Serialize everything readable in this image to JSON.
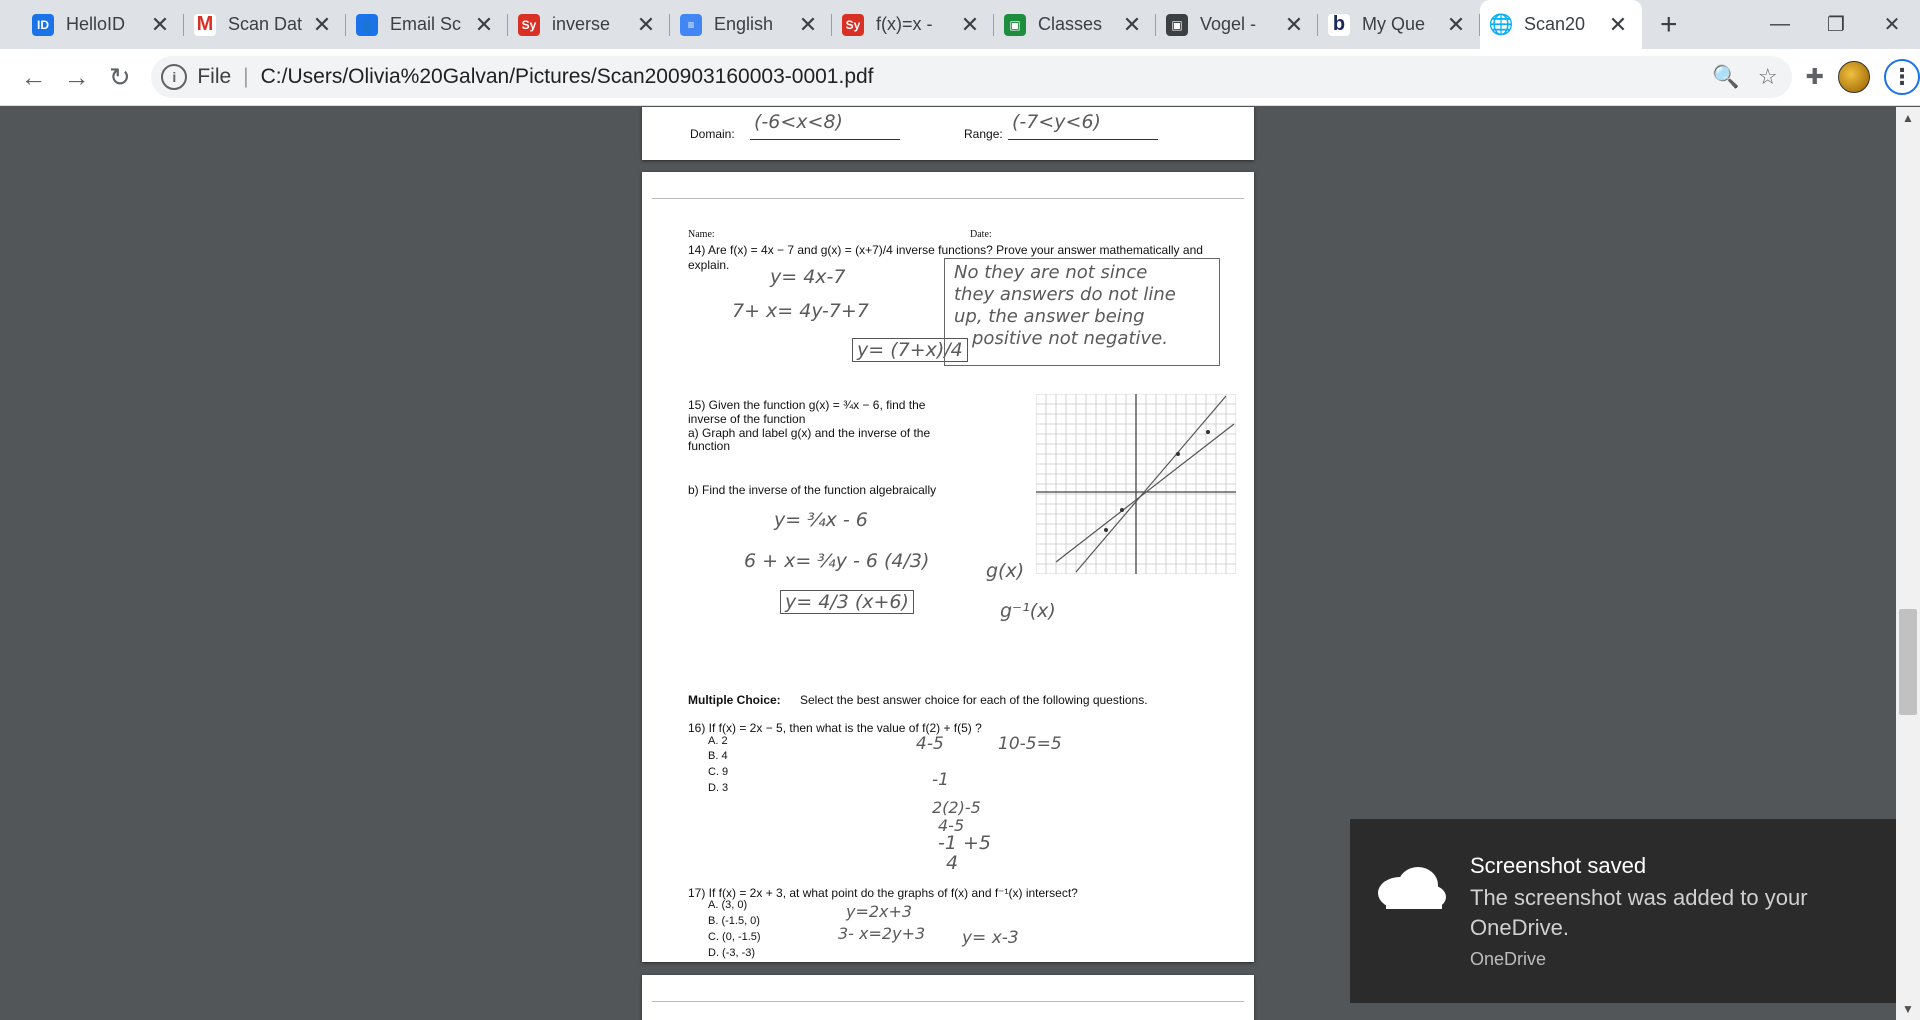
{
  "tabs": [
    {
      "label": "HelloID",
      "icon": "helloid-icon",
      "color": "#1a73e8",
      "glyph": "ID"
    },
    {
      "label": "Scan Data",
      "icon": "gmail-icon",
      "color": "#ffffff",
      "glyph": "M"
    },
    {
      "label": "Email Sc",
      "icon": "contacts-icon",
      "color": "#1a73e8",
      "glyph": "👤"
    },
    {
      "label": "inverse",
      "icon": "sy-icon",
      "color": "#d93025",
      "glyph": "Sy"
    },
    {
      "label": "English",
      "icon": "docs-icon",
      "color": "#4285f4",
      "glyph": "≡"
    },
    {
      "label": "f(x)=x -",
      "icon": "sy-icon",
      "color": "#d93025",
      "glyph": "Sy"
    },
    {
      "label": "Classes",
      "icon": "classroom-icon",
      "color": "#1e8e3e",
      "glyph": "▣"
    },
    {
      "label": "Vogel -",
      "icon": "meet-icon",
      "color": "#3c4043",
      "glyph": "▣"
    },
    {
      "label": "My Que",
      "icon": "b-icon",
      "color": "#ffffff",
      "glyph": "b"
    },
    {
      "label": "Scan20",
      "icon": "globe-icon",
      "color": "#ffffff",
      "glyph": "🌐"
    }
  ],
  "address": {
    "scheme": "File",
    "url": "C:/Users/Olivia%20Galvan/Pictures/Scan200903160003-0001.pdf"
  },
  "doc": {
    "domain_label": "Domain:",
    "domain_value": "(-6<x<8)",
    "range_label": "Range:",
    "range_value": "(-7<y<6)",
    "name_label": "Name:",
    "date_label": "Date:",
    "q14": "14) Are f(x) = 4x − 7 and g(x) = (x+7)/4 inverse functions? Prove your answer mathematically and",
    "q14b": "explain.",
    "q14_hw1": "y= 4x-7",
    "q14_hw2": "7+ x= 4y-7+7",
    "q14_hw3": "y= (7+x)/4",
    "q14_hw4": "No they are not since",
    "q14_hw5": "they answers do not line",
    "q14_hw6": "up, the answer being",
    "q14_hw7": "positive not negative.",
    "q15": "15) Given the function g(x) = ¾x − 6, find the",
    "q15b": "inverse of the function",
    "q15c": "a) Graph and label g(x) and the inverse of the",
    "q15d": "function",
    "q15e": "b) Find the inverse of the function algebraically",
    "q15_hw1": "y= ¾x - 6",
    "q15_hw2": "6 + x= ¾y - 6 (4/3)",
    "q15_hw3": "y= 4/3 (x+6)",
    "q15_hw_g": "g(x)",
    "q15_hw_ginv": "g⁻¹(x)",
    "mc_header": "Multiple Choice:",
    "mc_instr": "Select the best answer choice for each of the following questions.",
    "q16": "16)  If f(x) = 2x − 5, then what is the value of f(2) + f(5) ?",
    "q16_opts": [
      "A.  2",
      "B.  4",
      "C.  9",
      "D.  3"
    ],
    "q16_hw1": "4-5",
    "q16_hw2": "10-5=5",
    "q16_hw3": "-1",
    "q16_hw4": "2(2)-5",
    "q16_hw5": "4-5",
    "q16_hw6": "-1 +5",
    "q16_hw7": "4",
    "q17": "17) If f(x) = 2x + 3, at what point do the graphs of f(x) and f⁻¹(x) intersect?",
    "q17_opts": [
      "A.  (3, 0)",
      "B.  (-1.5, 0)",
      "C.  (0, -1.5)",
      "D.  (-3, -3)"
    ],
    "q17_hw1": "y=2x+3",
    "q17_hw2": "3- x=2y+3",
    "q17_hw3": "y= x-3"
  },
  "toast": {
    "title": "Screenshot saved",
    "body": "The screenshot was added to your OneDrive.",
    "app": "OneDrive"
  }
}
